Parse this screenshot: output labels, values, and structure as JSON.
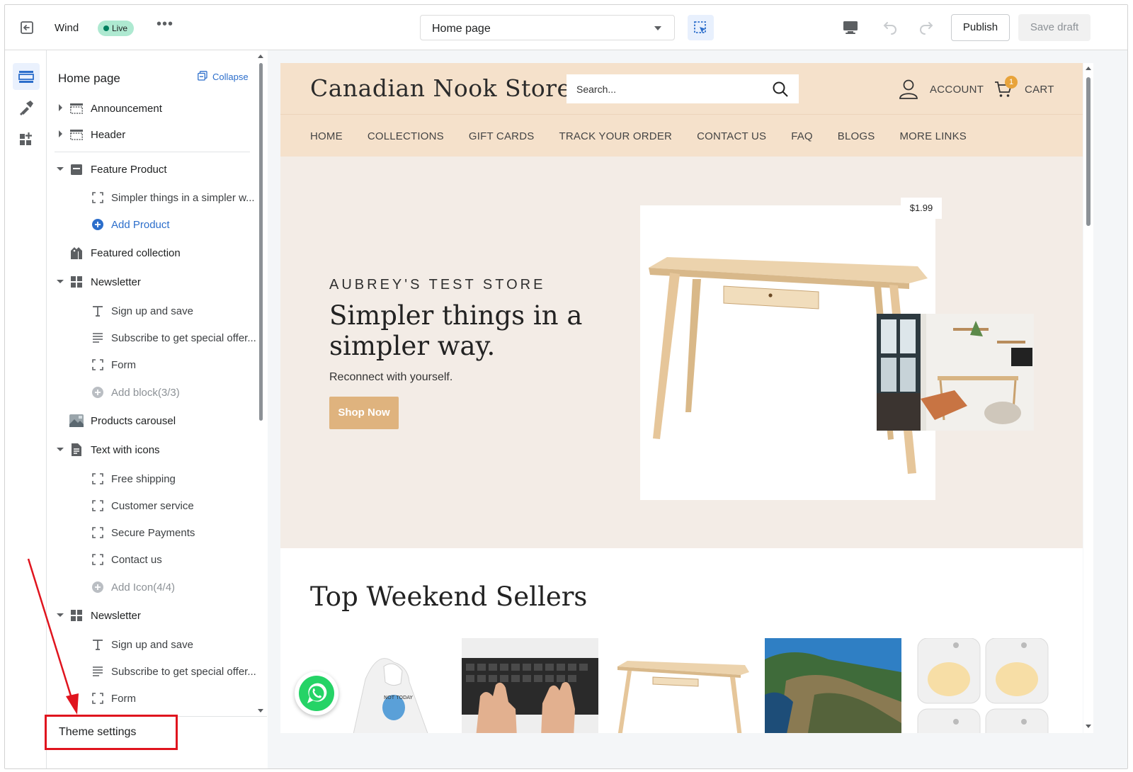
{
  "topbar": {
    "theme_name": "Wind",
    "live_badge": "Live",
    "more_label": "•••",
    "page_select": "Home page",
    "publish_label": "Publish",
    "save_draft_label": "Save draft"
  },
  "rail": {
    "items": [
      "sections-icon",
      "theme-customize-icon",
      "apps-icon"
    ]
  },
  "sidebar": {
    "title": "Home page",
    "collapse_label": "Collapse",
    "tree": [
      {
        "label": "Announcement",
        "level": 1,
        "caret": "right",
        "icon": "section-icon"
      },
      {
        "label": "Header",
        "level": 1,
        "caret": "right",
        "icon": "section-icon"
      },
      {
        "label": "Feature Product",
        "level": 1,
        "caret": "down",
        "icon": "product-icon"
      },
      {
        "label": "Simpler things in a simpler w...",
        "level": 2,
        "icon": "block-icon"
      },
      {
        "label": "Add Product",
        "level": 2,
        "icon": "add-circle-icon",
        "style": "blue"
      },
      {
        "label": "Featured collection",
        "level": 1,
        "icon": "collection-icon"
      },
      {
        "label": "Newsletter",
        "level": 1,
        "caret": "down",
        "icon": "grid-icon"
      },
      {
        "label": "Sign up and save",
        "level": 2,
        "icon": "text-icon"
      },
      {
        "label": "Subscribe to get special offer...",
        "level": 2,
        "icon": "paragraph-icon"
      },
      {
        "label": "Form",
        "level": 2,
        "icon": "block-icon"
      },
      {
        "label": "Add block(3/3)",
        "level": 2,
        "icon": "add-circle-icon",
        "style": "muted"
      },
      {
        "label": "Products carousel",
        "level": 1,
        "icon": "image-icon"
      },
      {
        "label": "Text with icons",
        "level": 1,
        "caret": "down",
        "icon": "document-icon"
      },
      {
        "label": "Free shipping",
        "level": 2,
        "icon": "block-icon"
      },
      {
        "label": "Customer service",
        "level": 2,
        "icon": "block-icon"
      },
      {
        "label": "Secure Payments",
        "level": 2,
        "icon": "block-icon"
      },
      {
        "label": "Contact us",
        "level": 2,
        "icon": "block-icon"
      },
      {
        "label": "Add Icon(4/4)",
        "level": 2,
        "icon": "add-circle-icon",
        "style": "muted"
      },
      {
        "label": "Newsletter",
        "level": 1,
        "caret": "down",
        "icon": "grid-icon"
      },
      {
        "label": "Sign up and save",
        "level": 2,
        "icon": "text-icon"
      },
      {
        "label": "Subscribe to get special offer...",
        "level": 2,
        "icon": "paragraph-icon"
      },
      {
        "label": "Form",
        "level": 2,
        "icon": "block-icon"
      }
    ],
    "theme_settings_label": "Theme settings"
  },
  "store": {
    "logo": "Canadian Nook Store",
    "search_placeholder": "Search...",
    "account_label": "ACCOUNT",
    "cart_label": "CART",
    "cart_count": "1",
    "nav": [
      "HOME",
      "COLLECTIONS",
      "GIFT CARDS",
      "TRACK YOUR ORDER",
      "CONTACT US",
      "FAQ",
      "BLOGS",
      "MORE LINKS"
    ],
    "hero": {
      "kicker": "AUBREY'S TEST STORE",
      "title": "Simpler things in a simpler way.",
      "subtitle": "Reconnect with yourself.",
      "button": "Shop Now",
      "price": "$1.99"
    },
    "sellers_title": "Top Weekend Sellers"
  },
  "colors": {
    "accent": "#2c6ecb",
    "live_green": "#aee9d1",
    "store_header": "#f5e1cb",
    "hero_bg": "#f3ece6",
    "cta": "#dfb37e",
    "highlight_box": "#e0141e"
  }
}
